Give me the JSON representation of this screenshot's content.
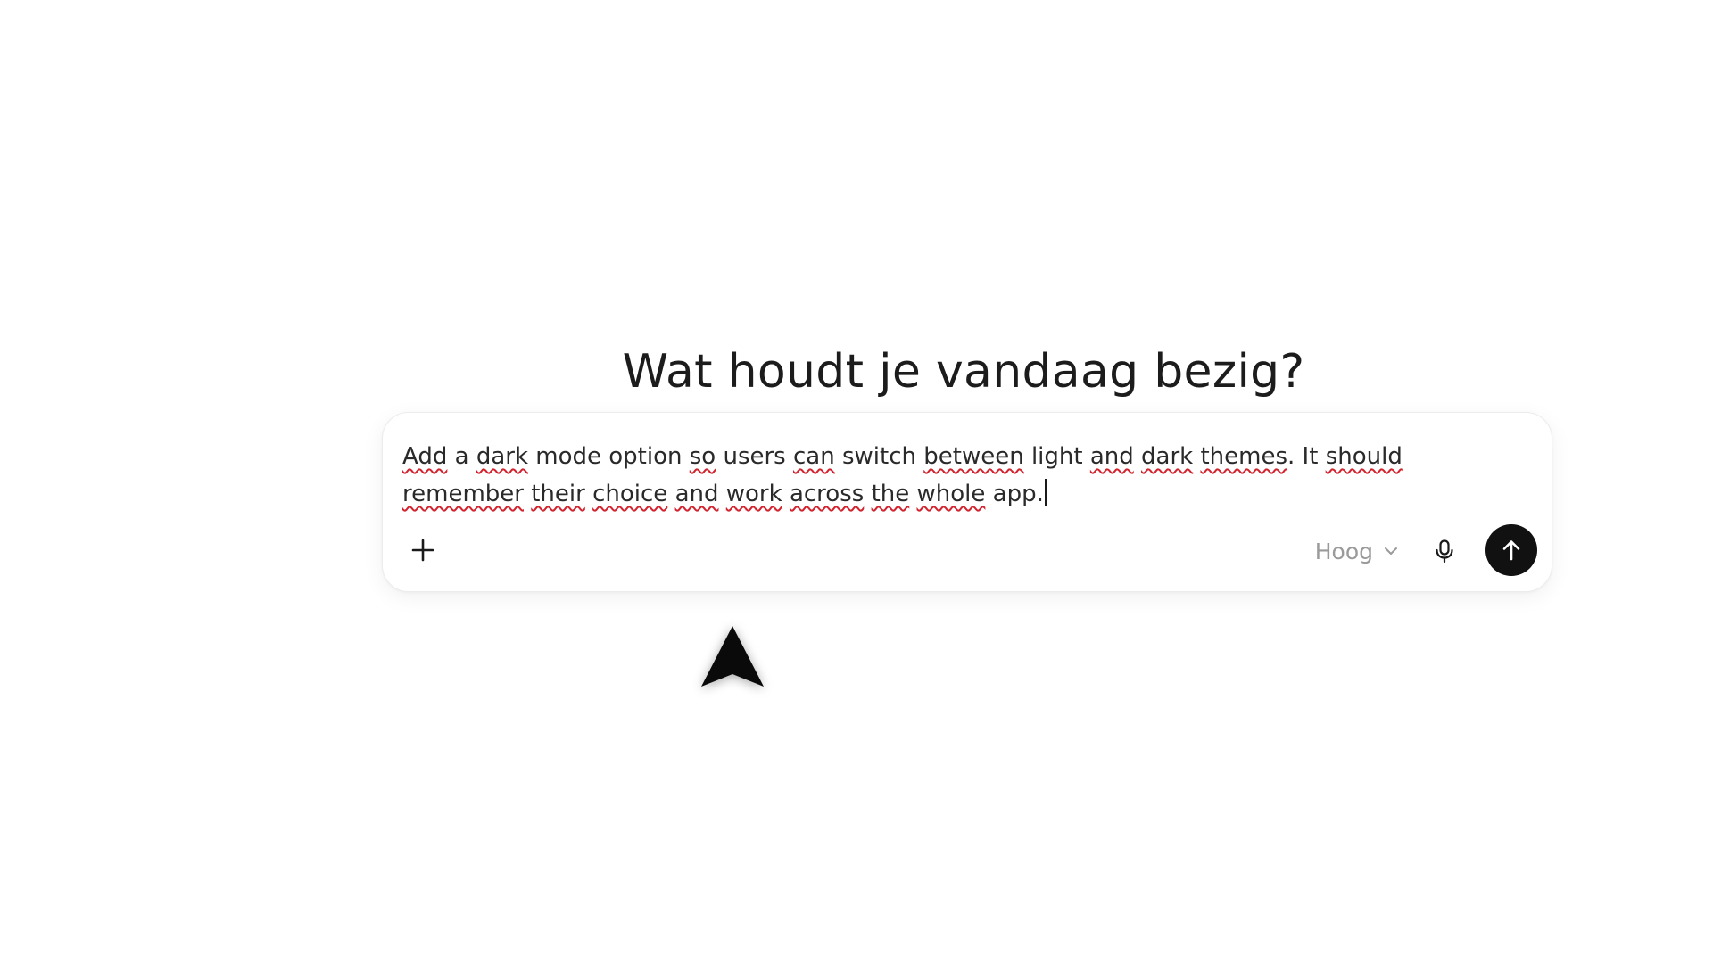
{
  "headline": "Wat houdt je vandaag bezig?",
  "composer": {
    "prompt_segments": [
      {
        "text": "Add",
        "spell": true
      },
      {
        "text": " a ",
        "spell": false
      },
      {
        "text": "dark",
        "spell": true
      },
      {
        "text": " mode option ",
        "spell": false
      },
      {
        "text": "so",
        "spell": true
      },
      {
        "text": " users ",
        "spell": false
      },
      {
        "text": "can",
        "spell": true
      },
      {
        "text": " switch ",
        "spell": false
      },
      {
        "text": "between",
        "spell": true
      },
      {
        "text": " light ",
        "spell": false
      },
      {
        "text": "and",
        "spell": true
      },
      {
        "text": " ",
        "spell": false
      },
      {
        "text": "dark",
        "spell": true
      },
      {
        "text": " ",
        "spell": false
      },
      {
        "text": "themes",
        "spell": true
      },
      {
        "text": ". It ",
        "spell": false
      },
      {
        "text": "should",
        "spell": true
      },
      {
        "text": " ",
        "spell": false
      },
      {
        "text": "remember",
        "spell": true
      },
      {
        "text": " ",
        "spell": false
      },
      {
        "text": "their",
        "spell": true
      },
      {
        "text": " ",
        "spell": false
      },
      {
        "text": "choice",
        "spell": true
      },
      {
        "text": " ",
        "spell": false
      },
      {
        "text": "and",
        "spell": true
      },
      {
        "text": " ",
        "spell": false
      },
      {
        "text": "work",
        "spell": true
      },
      {
        "text": " ",
        "spell": false
      },
      {
        "text": "across",
        "spell": true
      },
      {
        "text": " ",
        "spell": false
      },
      {
        "text": "the",
        "spell": true
      },
      {
        "text": " ",
        "spell": false
      },
      {
        "text": "whole",
        "spell": true
      },
      {
        "text": " app.",
        "spell": false
      }
    ],
    "reasoning_level": "Hoog",
    "icons": {
      "add": "plus-icon",
      "reasoning_dropdown": "chevron-down-icon",
      "voice": "microphone-icon",
      "send": "arrow-up-icon"
    }
  },
  "colors": {
    "send_button": "#111111",
    "spellcheck_underline": "#d1242f",
    "muted_text": "#9a9a9a"
  }
}
